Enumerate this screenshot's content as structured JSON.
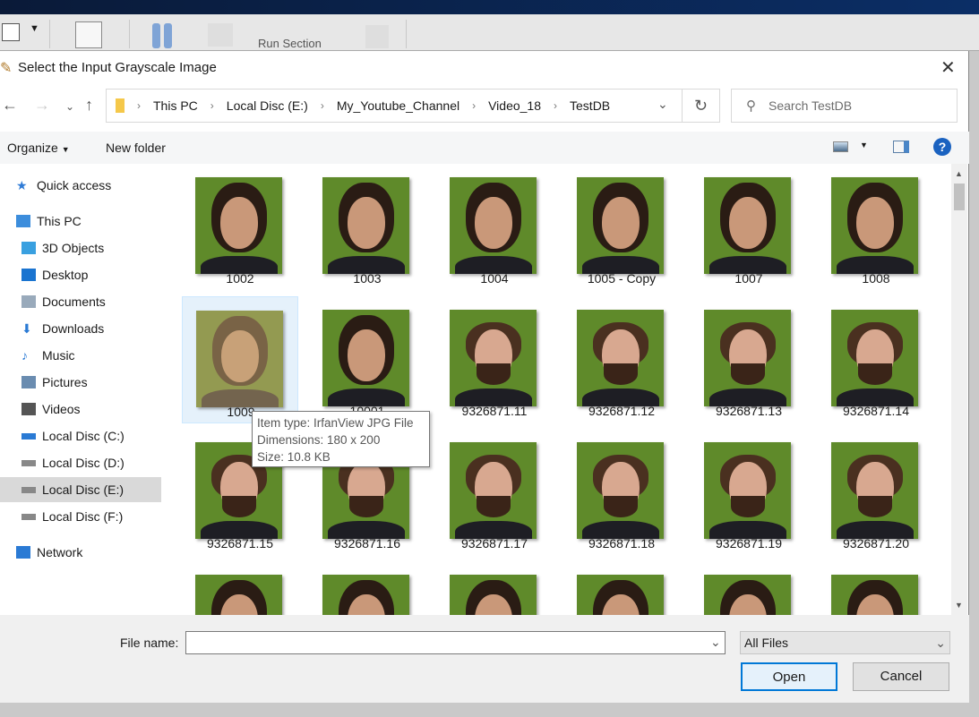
{
  "toolstrip": {
    "run_section": "Run Section"
  },
  "dialog": {
    "title": "Select the Input Grayscale Image"
  },
  "address": {
    "crumbs": [
      "This PC",
      "Local Disc (E:)",
      "My_Youtube_Channel",
      "Video_18",
      "TestDB"
    ]
  },
  "search": {
    "placeholder": "Search TestDB"
  },
  "command_bar": {
    "organize": "Organize",
    "new_folder": "New folder"
  },
  "sidebar": {
    "items": [
      {
        "label": "Quick access",
        "icon": "star-icon"
      },
      {
        "label": "This PC",
        "icon": "computer-icon"
      },
      {
        "label": "3D Objects",
        "icon": "cube-icon"
      },
      {
        "label": "Desktop",
        "icon": "desktop-icon"
      },
      {
        "label": "Documents",
        "icon": "document-icon"
      },
      {
        "label": "Downloads",
        "icon": "download-icon"
      },
      {
        "label": "Music",
        "icon": "music-icon"
      },
      {
        "label": "Pictures",
        "icon": "pictures-icon"
      },
      {
        "label": "Videos",
        "icon": "video-icon"
      },
      {
        "label": "Local Disc (C:)",
        "icon": "windows-drive-icon"
      },
      {
        "label": "Local Disc (D:)",
        "icon": "drive-icon"
      },
      {
        "label": "Local Disc (E:)",
        "icon": "drive-icon",
        "selected": true
      },
      {
        "label": "Local Disc (F:)",
        "icon": "drive-icon"
      },
      {
        "label": "Network",
        "icon": "network-icon"
      }
    ]
  },
  "files": [
    "1002",
    "1003",
    "1004",
    "1005 - Copy",
    "1007",
    "1008",
    "1009",
    "10001",
    "9326871.11",
    "9326871.12",
    "9326871.13",
    "9326871.14",
    "9326871.15",
    "9326871.16",
    "9326871.17",
    "9326871.18",
    "9326871.19",
    "9326871.20",
    "",
    "",
    "",
    "",
    "",
    ""
  ],
  "tooltip": {
    "type": "Item type: IrfanView JPG File",
    "dimensions": "Dimensions: 180 x 200",
    "size": "Size: 10.8 KB"
  },
  "bottom": {
    "file_name_label": "File name:",
    "file_name_value": "",
    "filter": "All Files",
    "open": "Open",
    "cancel": "Cancel"
  }
}
